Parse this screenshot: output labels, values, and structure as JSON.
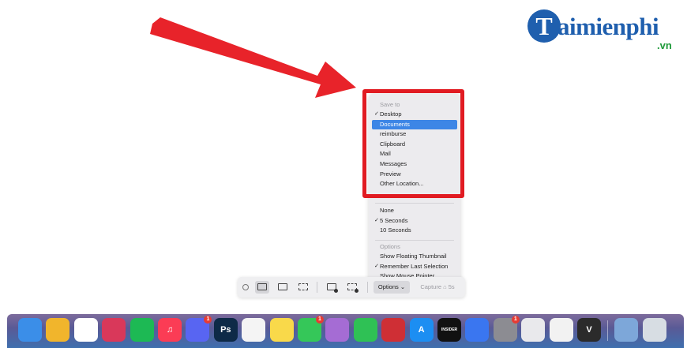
{
  "watermark": {
    "letter": "T",
    "word": "aimienphi",
    "tld": ".vn"
  },
  "menu": {
    "save_header": "Save to",
    "save_items": [
      {
        "label": "Desktop",
        "checked": true,
        "selected": false
      },
      {
        "label": "Documents",
        "checked": false,
        "selected": true
      },
      {
        "label": "reimburse",
        "checked": false,
        "selected": false
      },
      {
        "label": "Clipboard",
        "checked": false,
        "selected": false
      },
      {
        "label": "Mail",
        "checked": false,
        "selected": false
      },
      {
        "label": "Messages",
        "checked": false,
        "selected": false
      },
      {
        "label": "Preview",
        "checked": false,
        "selected": false
      },
      {
        "label": "Other Location...",
        "checked": false,
        "selected": false
      }
    ],
    "timer_items": [
      {
        "label": "None",
        "checked": false
      },
      {
        "label": "5 Seconds",
        "checked": true
      },
      {
        "label": "10 Seconds",
        "checked": false
      }
    ],
    "options_header": "Options",
    "option_items": [
      {
        "label": "Show Floating Thumbnail",
        "checked": false
      },
      {
        "label": "Remember Last Selection",
        "checked": true
      },
      {
        "label": "Show Mouse Pointer",
        "checked": false
      }
    ],
    "check_glyph": "✓"
  },
  "toolbar": {
    "options_label": "Options ⌄",
    "capture_label": "Capture ⌂ 5s"
  },
  "dock": {
    "items": [
      {
        "name": "finder-icon",
        "label": "",
        "color": "#3b8ee8",
        "badge": ""
      },
      {
        "name": "chrome-icon",
        "label": "",
        "color": "#f1b52c",
        "badge": ""
      },
      {
        "name": "slack-icon",
        "label": "",
        "color": "#ffffff",
        "badge": ""
      },
      {
        "name": "lips-app-icon",
        "label": "",
        "color": "#d9385a",
        "badge": ""
      },
      {
        "name": "spotify-icon",
        "label": "",
        "color": "#1db954",
        "badge": ""
      },
      {
        "name": "music-icon",
        "label": "♫",
        "color": "#fb3c55",
        "badge": ""
      },
      {
        "name": "discord-icon",
        "label": "",
        "color": "#5865f2",
        "badge": "1"
      },
      {
        "name": "photoshop-icon",
        "label": "Ps",
        "color": "#0e2a47",
        "badge": ""
      },
      {
        "name": "script-app-icon",
        "label": "",
        "color": "#f4f4f4",
        "badge": ""
      },
      {
        "name": "notes-icon",
        "label": "",
        "color": "#f9d94a",
        "badge": ""
      },
      {
        "name": "messages-icon",
        "label": "",
        "color": "#35c759",
        "badge": "1"
      },
      {
        "name": "grid-app-icon",
        "label": "",
        "color": "#a56cd4",
        "badge": ""
      },
      {
        "name": "facetime-icon",
        "label": "",
        "color": "#2fc155",
        "badge": ""
      },
      {
        "name": "photo-booth-icon",
        "label": "",
        "color": "#cf2f35",
        "badge": ""
      },
      {
        "name": "app-store-icon",
        "label": "A",
        "color": "#1c8ef2",
        "badge": ""
      },
      {
        "name": "insider-icon",
        "label": "INSIDER",
        "color": "#111111",
        "badge": ""
      },
      {
        "name": "signal-icon",
        "label": "",
        "color": "#3a76f0",
        "badge": ""
      },
      {
        "name": "system-preferences-icon",
        "label": "",
        "color": "#8c8c92",
        "badge": "1"
      },
      {
        "name": "pen-app-icon",
        "label": "",
        "color": "#e9e9ec",
        "badge": ""
      },
      {
        "name": "screenshot-app-icon",
        "label": "",
        "color": "#f2f2f2",
        "badge": ""
      },
      {
        "name": "vpn-app-icon",
        "label": "V",
        "color": "#2b2b2b",
        "badge": ""
      },
      {
        "name": "image-capture-icon",
        "label": "",
        "color": "#7da7d9",
        "badge": ""
      },
      {
        "name": "trash-icon",
        "label": "",
        "color": "#d7dde3",
        "badge": ""
      }
    ]
  }
}
